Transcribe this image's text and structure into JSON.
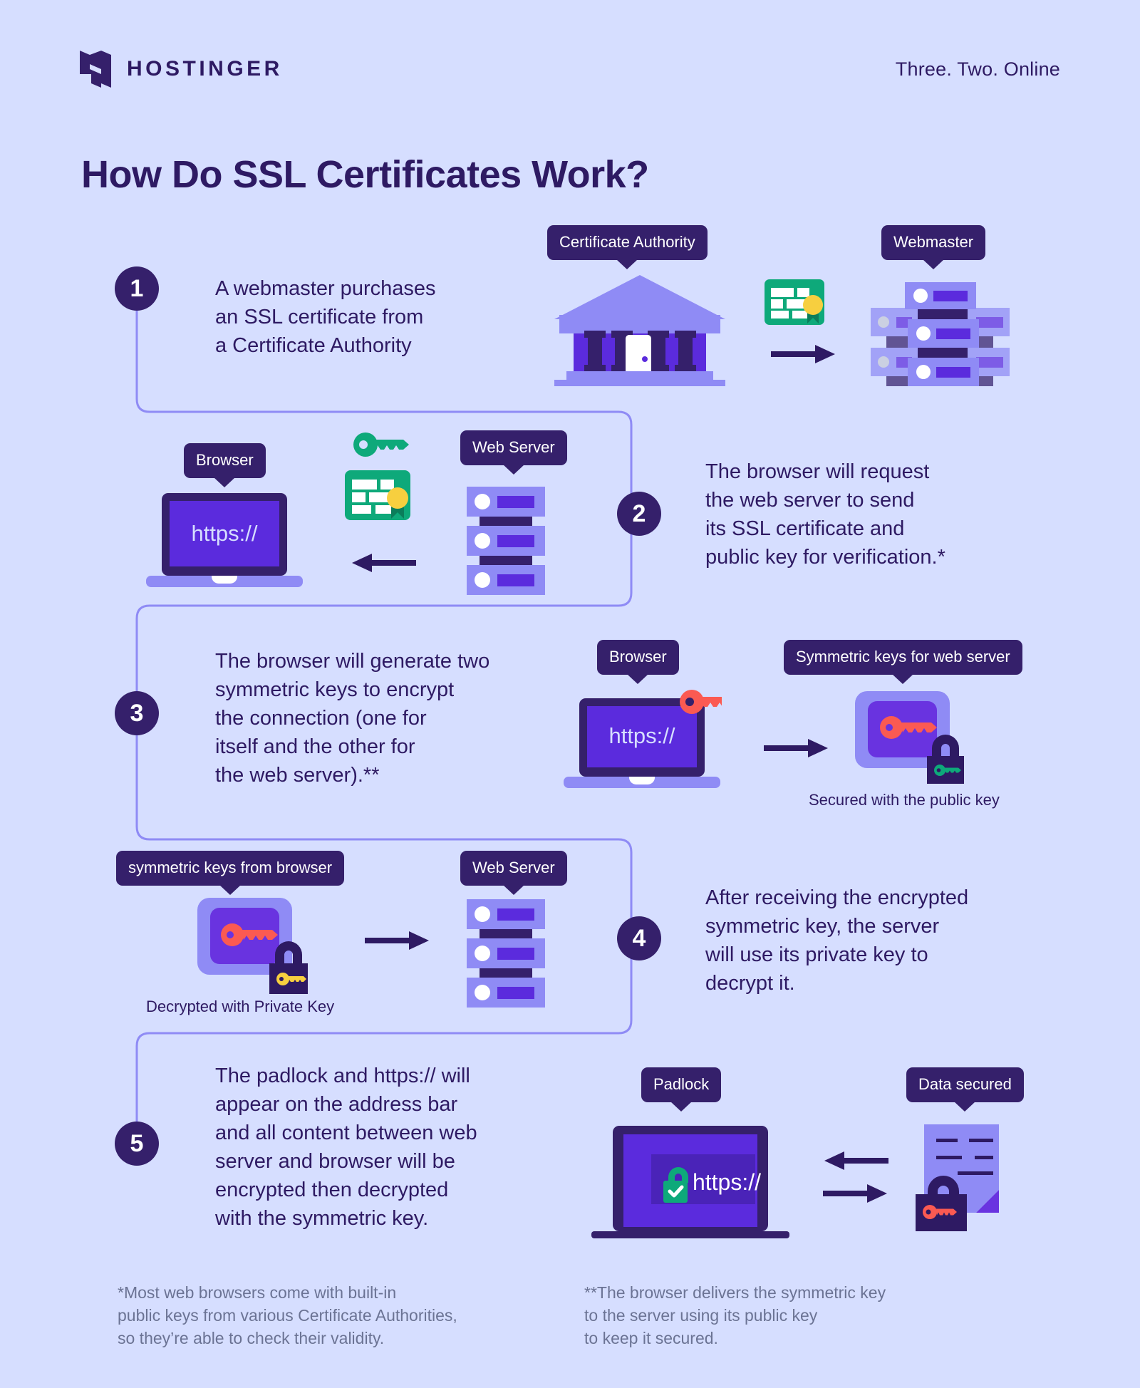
{
  "brand": {
    "name": "HOSTINGER",
    "logo_icon": "hostinger-h-logo",
    "tagline": "Three. Two. Online"
  },
  "title": "How Do SSL Certificates Work?",
  "colors": {
    "background": "#d6deff",
    "dark_purple": "#35206b",
    "mid_purple": "#5b2bdd",
    "light_purple": "#8f8bf5",
    "green": "#0ea97a",
    "yellow": "#f7cf3f",
    "red": "#fb5a52",
    "footnote_gray": "#6b7394"
  },
  "steps": [
    {
      "number": "1",
      "text": "A webmaster purchases\nan SSL certificate from\na Certificate Authority",
      "tags": [
        "Certificate Authority",
        "Webmaster"
      ],
      "icons": [
        "bank-icon",
        "certificate-icon",
        "arrow-right-icon",
        "server-stack-icon"
      ]
    },
    {
      "number": "2",
      "text": "The browser will request\nthe web server to send\nits SSL certificate and\npublic key for verification.*",
      "tags": [
        "Browser",
        "Web Server"
      ],
      "icons": [
        "laptop-https-icon",
        "key-icon",
        "certificate-icon",
        "arrow-left-icon",
        "server-icon"
      ]
    },
    {
      "number": "3",
      "text": "The browser will generate two\nsymmetric keys to encrypt\nthe connection (one for\nitself and the other for\nthe web server).**",
      "tags": [
        "Browser",
        "Symmetric keys for web server"
      ],
      "caption": "Secured with the public key",
      "icons": [
        "laptop-https-icon",
        "red-key-icon",
        "arrow-right-icon",
        "locked-keybox-icon"
      ]
    },
    {
      "number": "4",
      "text": "After receiving the encrypted\nsymmetric key, the server\nwill use its private key to\ndecrypt it.",
      "tags": [
        "symmetric keys from browser",
        "Web Server"
      ],
      "caption": "Decrypted with Private Key",
      "icons": [
        "unlocked-keybox-icon",
        "arrow-right-icon",
        "server-icon"
      ]
    },
    {
      "number": "5",
      "text": "The padlock and https:// will\nappear on the address bar\nand all content between web\nserver and browser will be\nencrypted then decrypted\nwith the symmetric key.",
      "tags": [
        "Padlock",
        "Data secured"
      ],
      "icons": [
        "laptop-padlock-icon",
        "arrow-left-icon",
        "arrow-right-icon",
        "secured-document-icon"
      ]
    }
  ],
  "screen_text": {
    "https": "https://"
  },
  "footnotes": [
    "*Most web browsers come with built-in\n public keys from various Certificate Authorities,\n so they’re able to check their validity.",
    "**The browser delivers the symmetric key\n  to the server using its public key\n  to keep it secured."
  ]
}
